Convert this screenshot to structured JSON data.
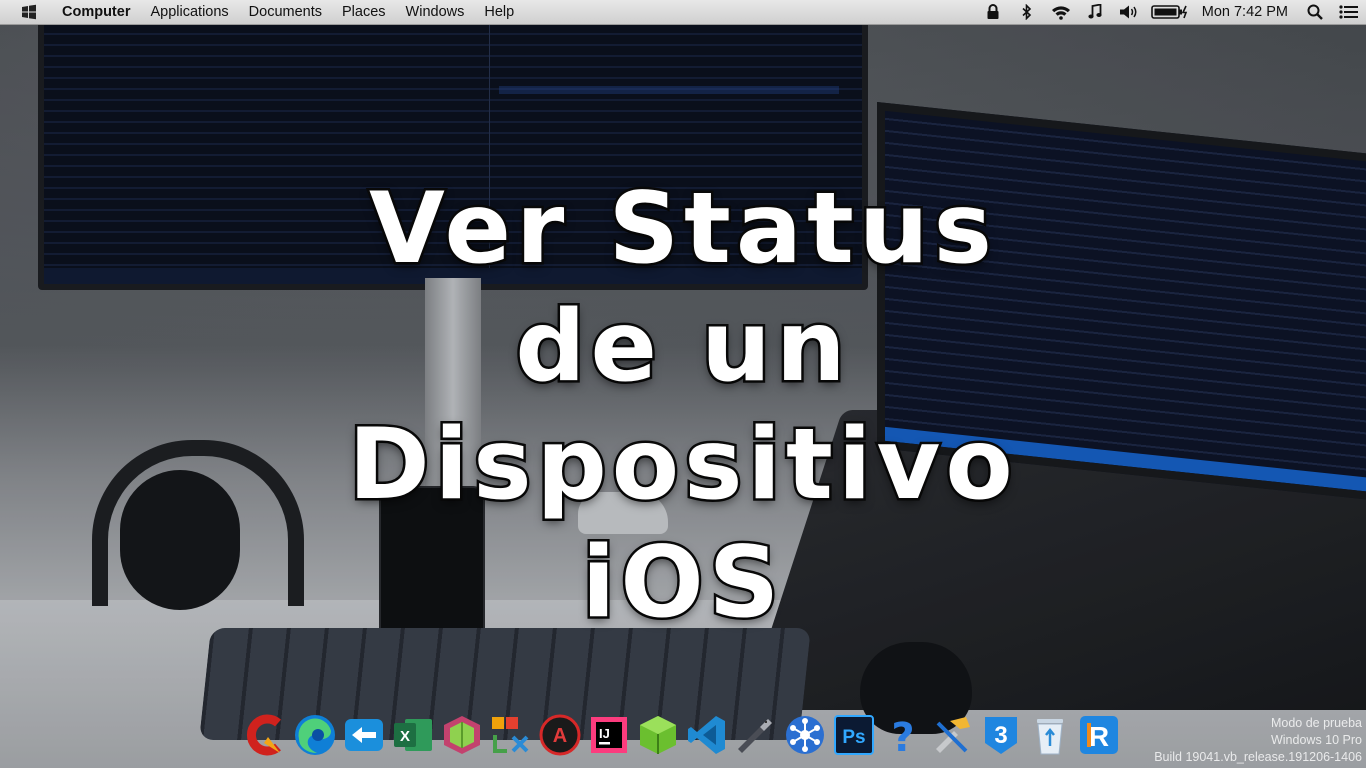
{
  "topbar": {
    "logo_icon": "windows-logo-icon",
    "menus": [
      "Computer",
      "Applications",
      "Documents",
      "Places",
      "Windows",
      "Help"
    ],
    "status_icons": [
      "lock-icon",
      "bluetooth-icon",
      "wifi-icon",
      "music-icon",
      "volume-icon",
      "battery-icon"
    ],
    "clock": "Mon 7:42 PM",
    "right_icons": [
      "search-icon",
      "menu-list-icon"
    ]
  },
  "title": {
    "lines": [
      "Ver Status",
      "de un",
      "Dispositivo",
      "iOS"
    ],
    "color": "#ffffff"
  },
  "dock": {
    "items": [
      "ccleaner-icon",
      "edge-icon",
      "remote-desktop-icon",
      "excel-icon",
      "box-app-icon",
      "xampp-lampp-icon",
      "recording-app-icon",
      "intellij-icon",
      "green-cube-icon",
      "vscode-icon",
      "usb-drive-icon",
      "network-hub-icon",
      "photoshop-icon",
      "help-icon",
      "xcode-tools-icon",
      "swift-3-icon",
      "recycle-bin-icon",
      "r-app-icon"
    ]
  },
  "watermark": {
    "line1": "Modo de prueba",
    "line2": "Windows 10 Pro",
    "line3": "Build 19041.vb_release.191206-1406"
  }
}
